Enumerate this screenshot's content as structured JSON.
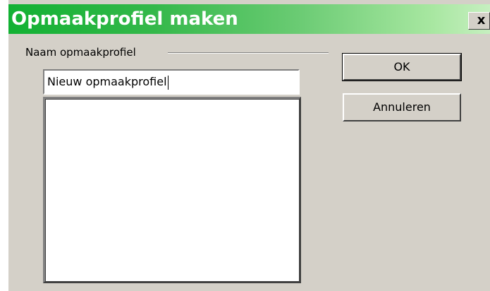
{
  "window": {
    "title": "Opmaakprofiel maken",
    "close_label": "x"
  },
  "form": {
    "group_label": "Naam opmaakprofiel",
    "name_value": "Nieuw opmaakprofiel",
    "existing_styles": []
  },
  "buttons": {
    "ok_label": "OK",
    "cancel_label": "Annuleren"
  },
  "colors": {
    "title_gradient_start": "#12b133",
    "title_gradient_end": "#c6efc0",
    "dialog_face": "#d4d0c8",
    "field_background": "#ffffff"
  }
}
